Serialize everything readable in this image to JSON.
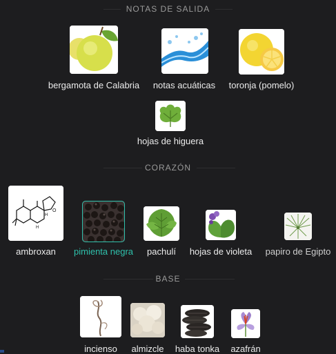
{
  "sections": {
    "top": {
      "title": "NOTAS DE SALIDA"
    },
    "heart": {
      "title": "CORAZÓN"
    },
    "base": {
      "title": "BASE"
    }
  },
  "notes": {
    "bergamota": {
      "label": "bergamota de Calabria",
      "icon": "bergamot-icon"
    },
    "acuaticas": {
      "label": "notas acuáticas",
      "icon": "water-splash-icon"
    },
    "toronja": {
      "label": "toronja (pomelo)",
      "icon": "grapefruit-icon"
    },
    "higuera": {
      "label": "hojas de higuera",
      "icon": "fig-leaf-icon"
    },
    "ambroxan": {
      "label": "ambroxan",
      "icon": "molecule-structure-icon"
    },
    "pimienta": {
      "label": "pimienta negra",
      "icon": "black-pepper-icon"
    },
    "pachuli": {
      "label": "pachulí",
      "icon": "patchouli-leaf-icon"
    },
    "violeta": {
      "label": "hojas de violeta",
      "icon": "violet-leaves-icon"
    },
    "papiro": {
      "label": "papiro de Egipto",
      "icon": "papyrus-icon"
    },
    "incienso": {
      "label": "incienso",
      "icon": "incense-smoke-icon"
    },
    "almizcle": {
      "label": "almizcle",
      "icon": "musk-cotton-icon"
    },
    "tonka": {
      "label": "haba tonka",
      "icon": "tonka-beans-icon"
    },
    "azafran": {
      "label": "azafrán",
      "icon": "saffron-flower-icon"
    }
  },
  "colors": {
    "background": "#1d1d1f",
    "accent": "#2fc1ac",
    "label": "#ececec",
    "section": "#9a9a9a"
  }
}
